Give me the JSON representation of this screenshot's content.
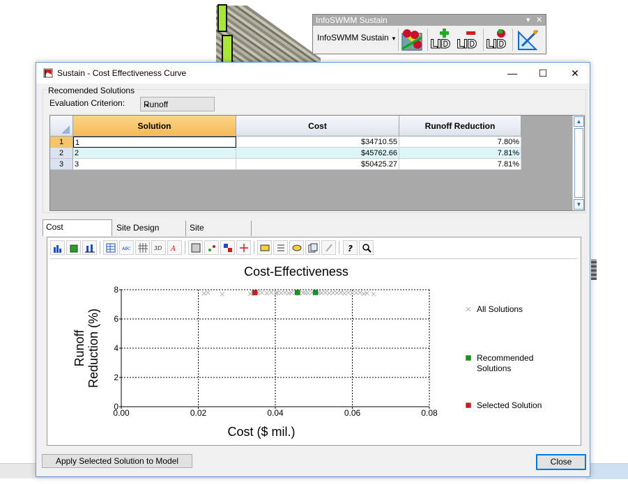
{
  "toolbar": {
    "title": "InfoSWMM Sustain",
    "dropdown_label": "InfoSWMM Sustain",
    "lid_label": "LID"
  },
  "dialog": {
    "title": "Sustain - Cost Effectiveness Curve",
    "group_label": "Recomended Solutions",
    "eval_label": "Evaluation Criterion:",
    "eval_value": "Runoff"
  },
  "grid": {
    "columns": [
      "Solution",
      "Cost",
      "Runoff Reduction"
    ],
    "rows": [
      {
        "num": "1",
        "solution": "1",
        "cost": "$34710.55",
        "reduction": "7.80%"
      },
      {
        "num": "2",
        "solution": "2",
        "cost": "$45762.66",
        "reduction": "7.81%"
      },
      {
        "num": "3",
        "solution": "3",
        "cost": "$50425.27",
        "reduction": "7.81%"
      }
    ]
  },
  "tabs": [
    "Cost Effectiveness",
    "Site Design Details",
    "Site Performance"
  ],
  "buttons": {
    "apply": "Apply Selected Solution to Model",
    "close": "Close"
  },
  "colors": {
    "recommended": "#119a11",
    "selected": "#d81818",
    "all_solutions": "#b0b0b0",
    "selected_column": "#f6c46b"
  },
  "chart_data": {
    "type": "scatter",
    "title": "Cost-Effectiveness",
    "xlabel": "Cost ($ mil.)",
    "ylabel": [
      "Runoff",
      "Reduction (%)"
    ],
    "xlim": [
      0,
      0.08
    ],
    "ylim": [
      0,
      8
    ],
    "xticks": [
      "0.00",
      "0.02",
      "0.04",
      "0.06",
      "0.08"
    ],
    "yticks": [
      "0",
      "2",
      "4",
      "6",
      "8"
    ],
    "grid": true,
    "legend_position": "right",
    "series": [
      {
        "name": "All Solutions",
        "marker": "x",
        "x": [
          0.0215,
          0.0225,
          0.0262,
          0.0335,
          0.0342,
          0.0355,
          0.0365,
          0.0378,
          0.039,
          0.0402,
          0.0405,
          0.0415,
          0.0425,
          0.0435,
          0.0442,
          0.0452,
          0.0462,
          0.0472,
          0.0478,
          0.0485,
          0.0495,
          0.0503,
          0.0512,
          0.052,
          0.053,
          0.054,
          0.055,
          0.056,
          0.057,
          0.058,
          0.059,
          0.06,
          0.061,
          0.062,
          0.063,
          0.0638,
          0.0655
        ],
        "y": [
          7.75,
          7.8,
          7.7,
          7.72,
          7.8,
          7.78,
          7.8,
          7.76,
          7.81,
          7.75,
          7.79,
          7.78,
          7.8,
          7.76,
          7.81,
          7.78,
          7.74,
          7.8,
          7.77,
          7.78,
          7.8,
          7.76,
          7.79,
          7.78,
          7.8,
          7.76,
          7.79,
          7.78,
          7.81,
          7.75,
          7.8,
          7.77,
          7.78,
          7.8,
          7.72,
          7.76,
          7.7
        ]
      },
      {
        "name": "Recommended Solutions",
        "marker": "square",
        "x": [
          0.0347,
          0.04576,
          0.05043
        ],
        "y": [
          7.8,
          7.81,
          7.81
        ]
      },
      {
        "name": "Selected Solution",
        "marker": "square",
        "x": [
          0.0347
        ],
        "y": [
          7.8
        ]
      }
    ]
  }
}
